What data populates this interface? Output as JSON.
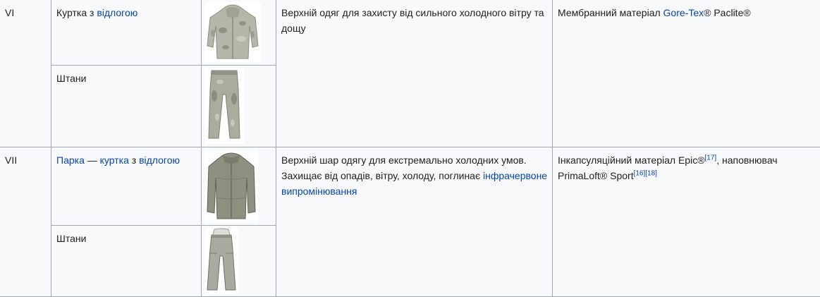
{
  "rows": [
    {
      "num": "VI",
      "top_item": {
        "prefix": "Куртка з ",
        "link": "відлогою"
      },
      "bottom_item": "Штани",
      "purpose": "Верхній одяг для захисту від сильного холодного вітру та дощу",
      "material": {
        "prefix": "Мембранний матеріал ",
        "link": "Gore-Tex",
        "suffix": "® Paclite®"
      }
    },
    {
      "num": "VII",
      "top_item": {
        "link1": "Парка",
        "sep": " — ",
        "link2": "куртка",
        "mid": " з ",
        "link3": "відлогою"
      },
      "bottom_item": "Штани",
      "purpose": {
        "text": "Верхній шар одягу для екстремально холодних умов. Захищає від опадів, вітру, холоду, поглинає ",
        "link": "інфрачервоне випромінювання"
      },
      "material": {
        "prefix": "Інкапсуляційний матеріал Epic®",
        "ref1": "[17]",
        "mid": ", наповнювач PrimaLoft® Sport",
        "ref2": "[16]",
        "ref3": "[18]"
      }
    }
  ]
}
